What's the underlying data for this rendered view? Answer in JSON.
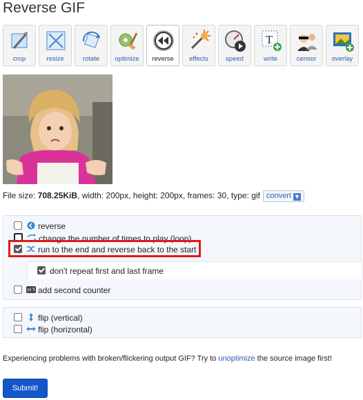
{
  "page": {
    "title": "Reverse GIF"
  },
  "toolbar": {
    "tools": [
      {
        "label": "crop",
        "icon": "crop-icon"
      },
      {
        "label": "resize",
        "icon": "resize-icon"
      },
      {
        "label": "rotate",
        "icon": "rotate-icon"
      },
      {
        "label": "optimize",
        "icon": "optimize-icon"
      },
      {
        "label": "reverse",
        "icon": "reverse-icon",
        "active": true
      },
      {
        "label": "effects",
        "icon": "effects-icon"
      },
      {
        "label": "speed",
        "icon": "speed-icon"
      },
      {
        "label": "write",
        "icon": "write-icon"
      },
      {
        "label": "censor",
        "icon": "censor-icon"
      },
      {
        "label": "overlay",
        "icon": "overlay-icon"
      }
    ]
  },
  "file_info": {
    "size_label": "File size: ",
    "size_value": "708.25KiB",
    "details": ", width: 200px, height: 200px, frames: 30, type: gif",
    "convert_label": "convert"
  },
  "options": {
    "reverse": {
      "label": "reverse",
      "checked": false
    },
    "loop": {
      "label": "change the number of times to play (loop)",
      "checked": false
    },
    "run_to_end": {
      "label": "run to the end and reverse back to the start",
      "checked": true
    },
    "dont_repeat": {
      "label": "don't repeat first and last frame",
      "checked": true
    },
    "second_counter": {
      "label": "add second counter",
      "checked": false
    },
    "flip_vertical": {
      "label": "flip (vertical)",
      "checked": false
    },
    "flip_horizontal": {
      "label": "flip (horizontal)",
      "checked": false
    }
  },
  "notice": {
    "before": "Experiencing problems with broken/flickering output GIF? Try to ",
    "link": "unoptimize",
    "after": " the source image first!"
  },
  "submit": {
    "label": "Submit!"
  },
  "colors": {
    "accent": "#1457c8",
    "highlight": "#e01818",
    "link": "#2a5db0"
  }
}
